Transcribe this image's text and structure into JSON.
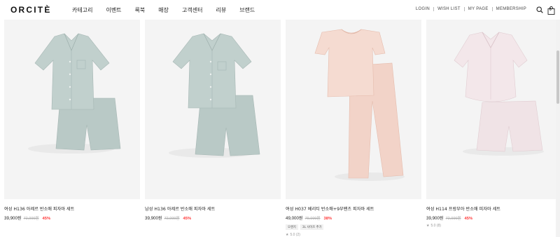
{
  "header": {
    "logo": "ORCITÈ",
    "nav": [
      "카테고리",
      "이벤트",
      "룩북",
      "매장",
      "고객센터",
      "리뷰",
      "브랜드"
    ],
    "util": [
      "LOGIN",
      "WISH LIST",
      "MY PAGE",
      "MEMBERSHIP"
    ],
    "search_icon": "search-icon",
    "cart_icon": "shopping-bag-icon",
    "cart_count": "0"
  },
  "products": [
    {
      "name": "여성 H136 아제르 반소매 피자마 세트",
      "price": "39,900원",
      "original_price": "72,000원",
      "discount": "45%",
      "image_color": "#b9c9c6"
    },
    {
      "name": "남성 H136 아제르 반소매 피자마 세트",
      "price": "39,900원",
      "original_price": "72,000원",
      "discount": "45%",
      "image_color": "#b9c9c6"
    },
    {
      "name": "여성 H037 베리티 반소매+9부팬츠 피자마 세트",
      "price": "49,000원",
      "original_price": "79,000원",
      "discount": "38%",
      "tags": [
        "오렌지",
        "3L 사이즈 추가"
      ],
      "rating": "5.0 (2)",
      "image_color": "#f2d3c8"
    },
    {
      "name": "여성 H114 프랑부아 반소매 피자마 세트",
      "price": "39,900원",
      "original_price": "72,000원",
      "discount": "45%",
      "rating": "5.0 (8)",
      "image_color": "#f0e3e6"
    }
  ],
  "colors": {
    "discount": "#ff3b3b",
    "thumb_bg": "#f4f4f4"
  }
}
